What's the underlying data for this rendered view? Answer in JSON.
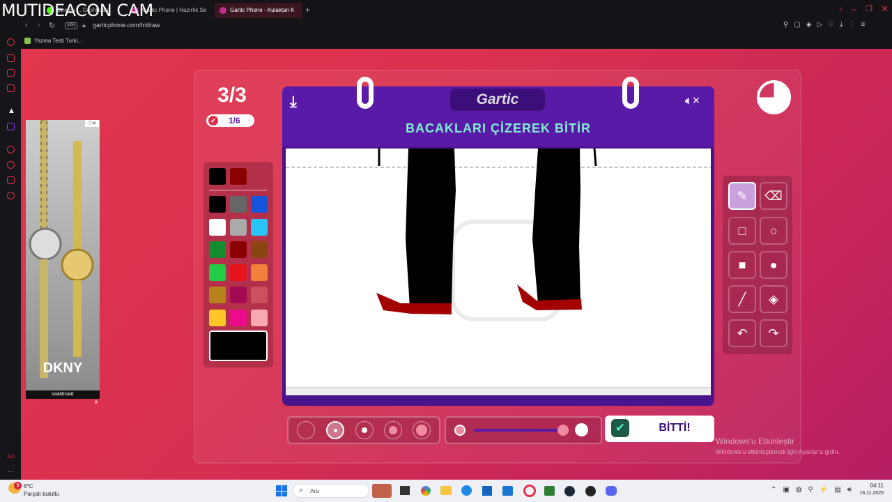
{
  "overlay": {
    "text": "MUTIDEACON CAM"
  },
  "tabs": [
    {
      "label": "Stream ... Dashboard",
      "color": "#53fc18"
    },
    {
      "label": "Gartic Phone | Hazırlık Se",
      "color": "#c0308a"
    },
    {
      "label": "Gartic Phone - Kulaktan K",
      "color": "#c0308a"
    }
  ],
  "address": {
    "vpn": "VPN",
    "url": "garticphone.com/tr/draw"
  },
  "bookmarks": [
    {
      "label": "Yazma Testi Turki..."
    }
  ],
  "game": {
    "round": "3/3",
    "done_count": "1/6",
    "logo": "Gartic",
    "instruction": "BACAKLARI ÇİZEREK BİTİR",
    "done_button": "BİTTİ!"
  },
  "ad": {
    "brand": "DKNY",
    "store": "saat&saat",
    "badge": "A"
  },
  "palette": {
    "recent": [
      "#000000",
      "#8b0000"
    ],
    "colors": [
      "#000000",
      "#666666",
      "#1455d9",
      "#ffffff",
      "#aaaaaa",
      "#29c5f6",
      "#148c2e",
      "#8b0000",
      "#8b4513",
      "#22cc44",
      "#e8141c",
      "#f2803a",
      "#b5821b",
      "#a30a54",
      "#cc5060",
      "#ffc629",
      "#ec0b8a",
      "#f7a8b0"
    ],
    "current": "#000000"
  },
  "tools": [
    "pen-icon",
    "eraser-icon",
    "rect-outline-icon",
    "circle-outline-icon",
    "rect-fill-icon",
    "circle-fill-icon",
    "line-icon",
    "bucket-icon",
    "undo-icon",
    "redo-icon"
  ],
  "watermark": {
    "title": "Windows'u Etkinleştir",
    "subtitle": "Windows'u etkinleştirmek için Ayarlar'a gidin."
  },
  "taskbar": {
    "weather_temp": "6°C",
    "weather_desc": "Parçalı bulutlu",
    "weather_badge": "9",
    "search": "Ara",
    "time": "04:11",
    "date": "16.11.2025"
  },
  "colors": {
    "accent": "#5a1aa8",
    "instruction": "#7ff0d0",
    "page": "#d8304f"
  }
}
